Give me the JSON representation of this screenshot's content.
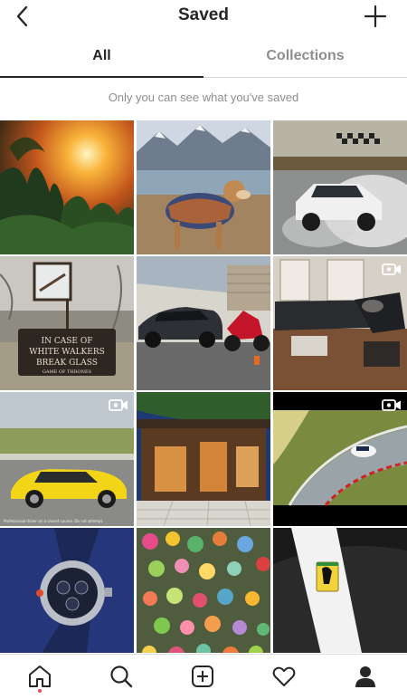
{
  "header": {
    "title": "Saved",
    "back_icon": "chevron-left-icon",
    "add_icon": "plus-icon"
  },
  "tabs": [
    {
      "label": "All",
      "active": true
    },
    {
      "label": "Collections",
      "active": false
    }
  ],
  "notice": "Only you can see what you've saved",
  "grid": {
    "items": [
      {
        "name": "sunset-trees-photo",
        "video": false
      },
      {
        "name": "dog-mountains-photo",
        "video": false
      },
      {
        "name": "drifting-car-photo",
        "video": false
      },
      {
        "name": "white-walkers-sign-photo",
        "video": false,
        "caption_lines": [
          "IN CASE OF",
          "WHITE WALKERS",
          "BREAK GLASS",
          "GAME OF THRONES"
        ]
      },
      {
        "name": "supercar-motorcycle-photo",
        "video": false
      },
      {
        "name": "living-room-photo",
        "video": true
      },
      {
        "name": "yellow-porsche-photo",
        "video": true,
        "caption": "Professional driver on a closed course. Do not attempt."
      },
      {
        "name": "rooftop-terrace-photo",
        "video": false
      },
      {
        "name": "race-track-aerial-photo",
        "video": true
      },
      {
        "name": "luxury-watch-photo",
        "video": false
      },
      {
        "name": "colorful-food-photo",
        "video": false
      },
      {
        "name": "ferrari-badge-photo",
        "video": false
      }
    ]
  },
  "bottom_nav": [
    {
      "name": "home-icon",
      "active": true
    },
    {
      "name": "search-icon",
      "active": false
    },
    {
      "name": "add-post-icon",
      "active": false
    },
    {
      "name": "heart-icon",
      "active": false
    },
    {
      "name": "profile-icon",
      "active": false
    }
  ],
  "colors": {
    "text": "#262626",
    "muted": "#8e8e8e",
    "divider": "#dbdbdb",
    "notification": "#ed4956"
  }
}
